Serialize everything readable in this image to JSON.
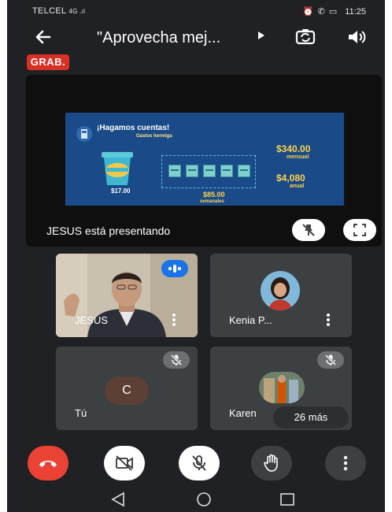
{
  "status_bar": {
    "carrier": "TELCEL",
    "signal": "4G .ıl",
    "icons": "⏰ ✆ ▭",
    "time": "11:25"
  },
  "header": {
    "back_icon": "arrow-back-icon",
    "title": "\"Aprovecha mej...",
    "play_icon": "play-icon",
    "switch_camera_icon": "switch-camera-icon",
    "speaker_icon": "speaker-icon"
  },
  "recording_badge": "GRAB.",
  "presentation": {
    "slide": {
      "heading": "¡Hagamos cuentas!",
      "subheading": "Gastos hormiga",
      "cup_price": "$17.00",
      "weekly_amount": "$85.00",
      "weekly_label": "semanales",
      "monthly_amount": "$340.00",
      "monthly_label": "mensual",
      "yearly_amount": "$4,080",
      "yearly_label": "anual",
      "coin_count": 5
    },
    "presenting_text": "JESUS está presentando",
    "unpin_icon": "unpin-icon",
    "fullscreen_icon": "fullscreen-icon"
  },
  "participants": [
    {
      "name": "JESUS",
      "avatar": "camera-video",
      "speaking": true
    },
    {
      "name": "Kenia P...",
      "avatar": "photo",
      "muted": false
    },
    {
      "name": "Tú",
      "avatar_letter": "C",
      "muted": true
    },
    {
      "name": "Karen",
      "avatar": "photo",
      "muted": true
    }
  ],
  "more_participants": "26 más",
  "controls": {
    "end_call_icon": "end-call-icon",
    "camera_off_icon": "camera-off-icon",
    "mic_off_icon": "mic-off-icon",
    "raise_hand_icon": "raise-hand-icon",
    "more_options_icon": "more-options-icon"
  },
  "colors": {
    "background": "#202124",
    "tile": "#3c4043",
    "record_red": "#d93025",
    "end_call_red": "#ea4335",
    "speaking_blue": "#1a73e8",
    "slide_blue": "#1a4a88",
    "slide_gold": "#ffd24a"
  }
}
